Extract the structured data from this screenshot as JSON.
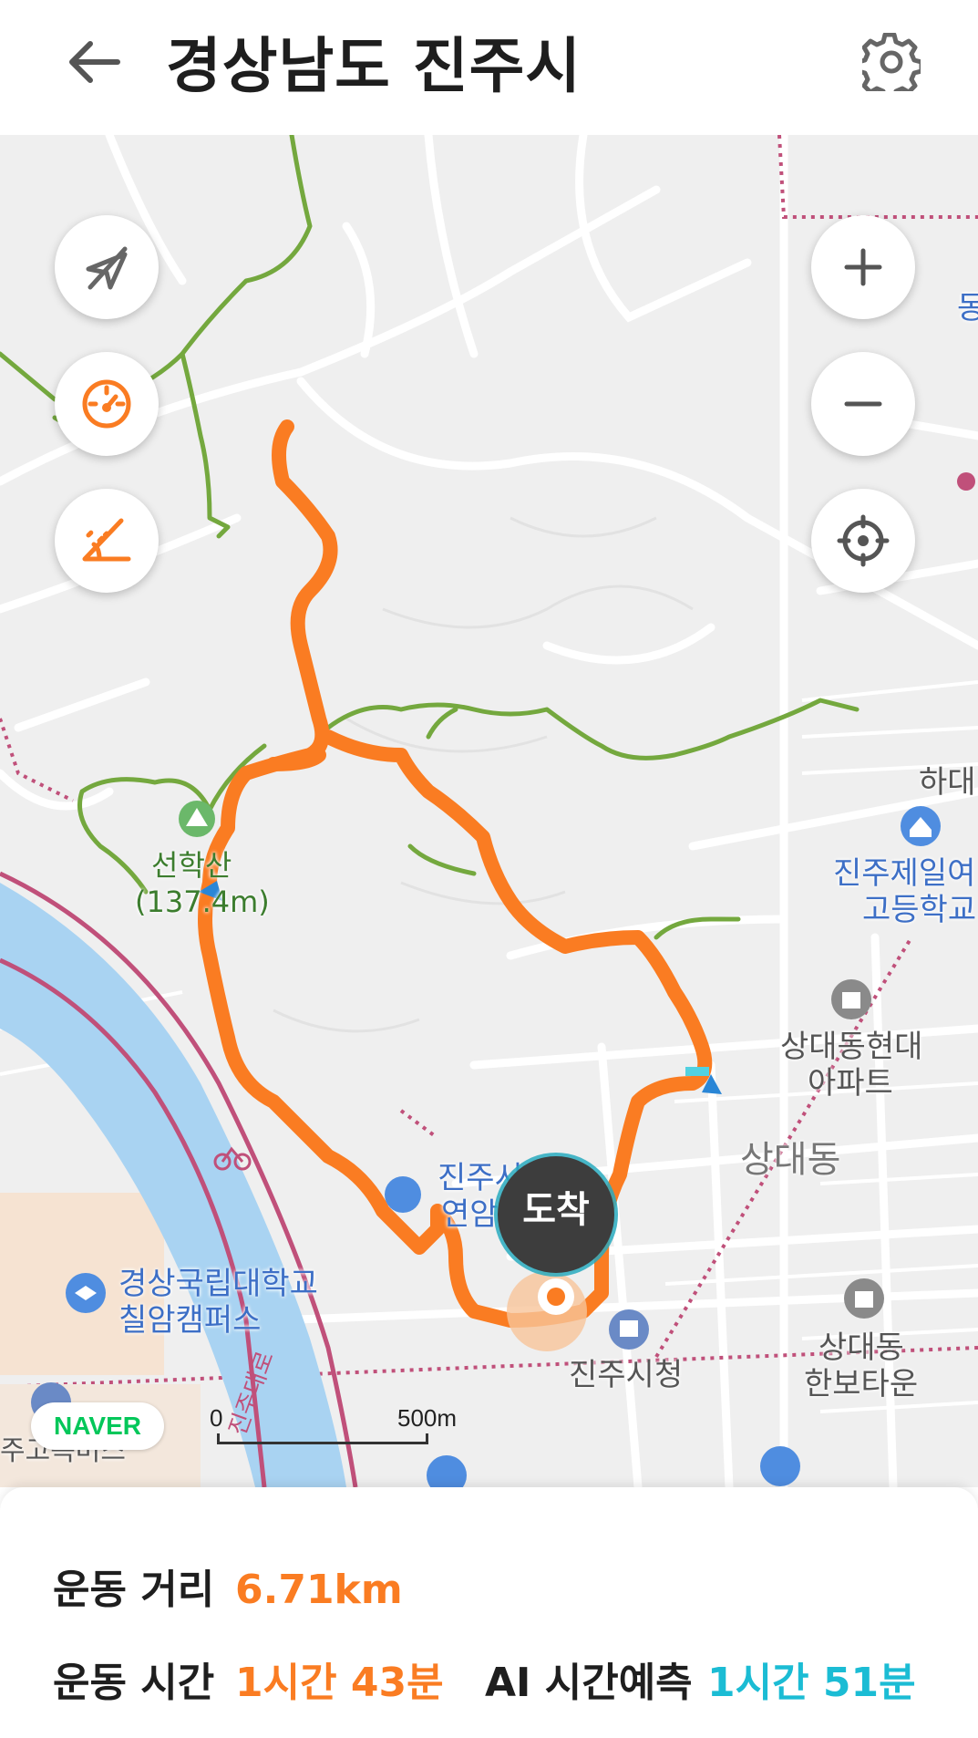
{
  "header": {
    "title": "경상남도 진주시",
    "back_icon": "arrow-left-icon",
    "settings_icon": "gear-icon"
  },
  "map": {
    "controls_left": [
      {
        "name": "compass-off-button",
        "icon": "compass-slash-icon"
      },
      {
        "name": "speed-button",
        "icon": "speedometer-icon"
      },
      {
        "name": "slope-button",
        "icon": "slope-angle-icon"
      }
    ],
    "controls_right": [
      {
        "name": "zoom-in-button",
        "icon": "plus-icon"
      },
      {
        "name": "zoom-out-button",
        "icon": "minus-icon"
      },
      {
        "name": "my-location-button",
        "icon": "crosshair-icon"
      }
    ],
    "labels": {
      "peak_name": "선학산",
      "peak_height": "(137.4m)",
      "school1_line1": "진주제일여",
      "school1_line2": "고등학교",
      "district_hadae": "하대",
      "apt1_line1": "상대동현대",
      "apt1_line2": "아파트",
      "district_sangdae": "상대동",
      "apt2_line1": "상대동",
      "apt2_line2": "한보타운",
      "city_hall": "진주시청",
      "univ_line1": "경상국립대학교",
      "univ_line2": "칠암캠퍼스",
      "partial_label_1": "진주시",
      "partial_label_2": "연암",
      "partial_bottom": "주고속버스",
      "partial_right_top": "동",
      "road_name": "진주대로"
    },
    "arrival_badge": "도착",
    "naver_logo": "NAVER",
    "scale_zero": "0",
    "scale_max": "500m",
    "colors": {
      "route": "#fa7c22",
      "trail": "#74a83e",
      "river": "#a9d3f2",
      "boundary": "#c0507a"
    }
  },
  "stats": {
    "distance_label": "운동 거리",
    "distance_value": "6.71km",
    "time_label": "운동 시간",
    "time_value": "1시간 43분",
    "ai_label": "AI 시간예측",
    "ai_value": "1시간 51분"
  }
}
